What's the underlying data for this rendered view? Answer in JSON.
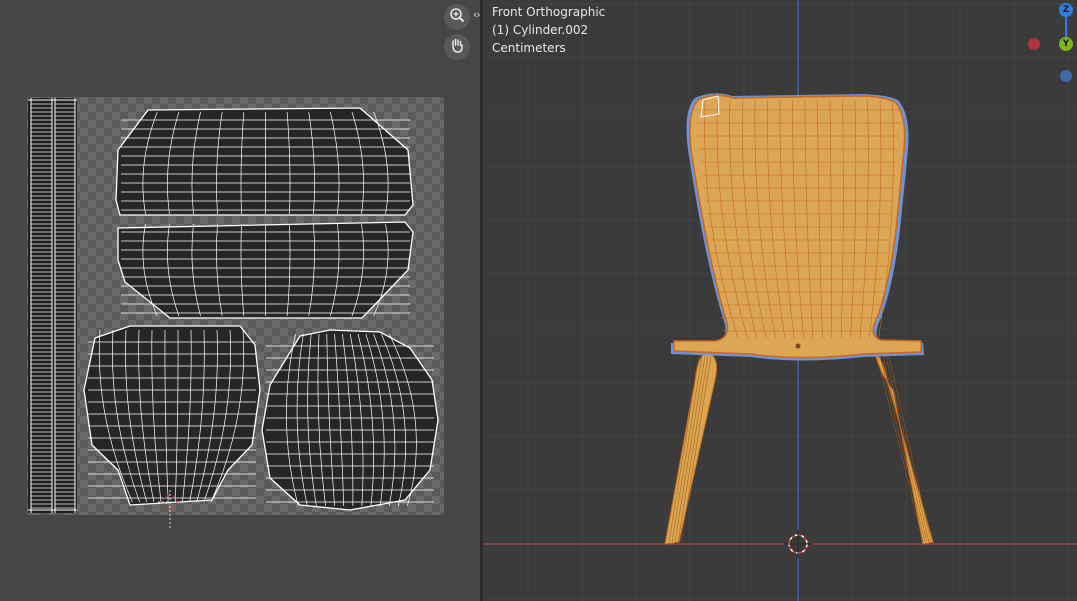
{
  "uv_editor": {
    "tools": {
      "zoom_icon": "magnifier-plus-icon",
      "pan_icon": "hand-icon"
    }
  },
  "viewport": {
    "view_name": "Front Orthographic",
    "object_label": "(1) Cylinder.002",
    "units": "Centimeters",
    "gizmo": {
      "z_label": "Z",
      "y_label": "Y",
      "z_color": "#2f7fe0",
      "y_color": "#7db51c",
      "x_color": "#b03540",
      "neg_y_color": "#3f6aa6"
    },
    "colors": {
      "seat_fill": "#d9a551",
      "wire": "#c96a1e",
      "outline": "#6f93d6",
      "axis_x": "#a24545",
      "axis_z": "#3f6fc8"
    }
  }
}
